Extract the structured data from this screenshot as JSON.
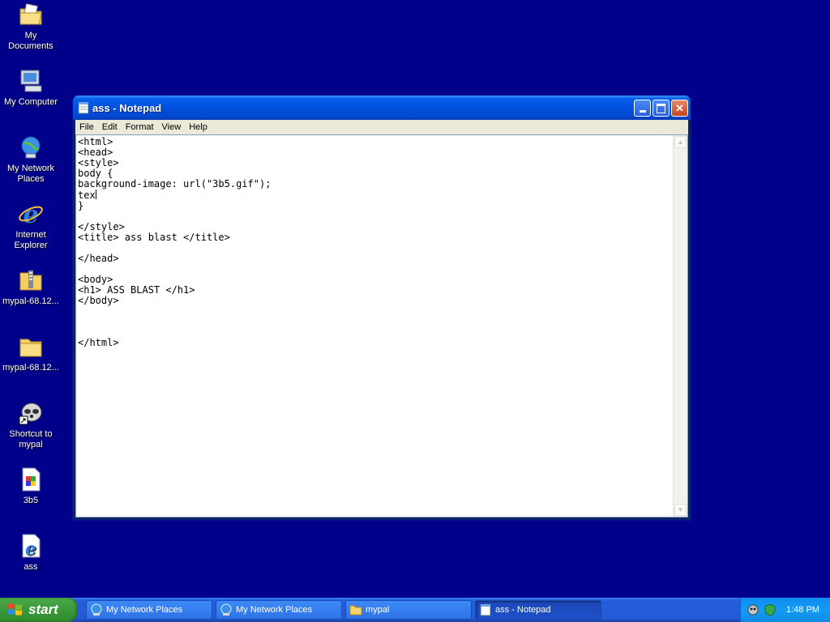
{
  "desktop": {
    "icons": [
      {
        "label": "My Documents",
        "icon": "my-documents-icon"
      },
      {
        "label": "My Computer",
        "icon": "my-computer-icon"
      },
      {
        "label": "My Network Places",
        "icon": "network-places-icon"
      },
      {
        "label": "Internet Explorer",
        "icon": "internet-explorer-icon"
      },
      {
        "label": "mypal-68.12...",
        "icon": "zip-folder-icon"
      },
      {
        "label": "mypal-68.12...",
        "icon": "folder-icon"
      },
      {
        "label": "Shortcut to mypal",
        "icon": "mypal-shortcut-icon"
      },
      {
        "label": "3b5",
        "icon": "gif-image-icon"
      },
      {
        "label": "ass",
        "icon": "html-document-icon"
      }
    ]
  },
  "window": {
    "title": "ass - Notepad",
    "menu": [
      "File",
      "Edit",
      "Format",
      "View",
      "Help"
    ],
    "content_before_caret": "<html>\n<head>\n<style>\nbody {\nbackground-image: url(\"3b5.gif\");\ntex",
    "content_after_caret": "\n}\n\n</style>\n<title> ass blast </title>\n\n</head>\n\n<body>\n<h1> ASS BLAST </h1>\n</body>\n\n\n\n</html>"
  },
  "taskbar": {
    "start_label": "start",
    "tasks": [
      {
        "label": "My Network Places",
        "icon": "network-places-icon",
        "active": false
      },
      {
        "label": "My Network Places",
        "icon": "network-places-icon",
        "active": false
      },
      {
        "label": "mypal",
        "icon": "folder-icon",
        "active": false
      },
      {
        "label": "ass - Notepad",
        "icon": "notepad-icon",
        "active": true
      }
    ],
    "clock": "1:48 PM"
  },
  "colors": {
    "desktop_background": "#00008b",
    "titlebar": "#0054e3",
    "start_button": "#3a9a3a",
    "taskbar": "#245edb"
  }
}
